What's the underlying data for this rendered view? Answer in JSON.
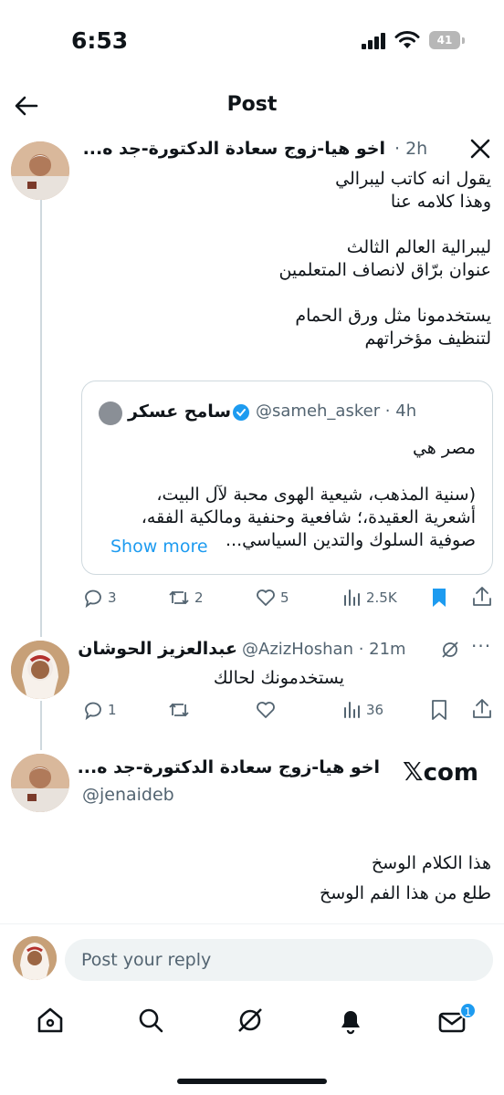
{
  "status_bar": {
    "time": "6:53",
    "battery": "41"
  },
  "header": {
    "title": "Post"
  },
  "post1": {
    "author": "اخو هيا-زوج سعادة الدكتورة-جد ه...",
    "time": "· 2h",
    "text": "يقول انه كاتب ليبرالي\nوهذا كلامه عنا\n\nليبرالية العالم الثالث\nعنوان برّاق لانصاف المتعلمين\n\nيستخدمونا مثل ورق الحمام\nلتنظيف مؤخراتهم",
    "quote": {
      "name": "سامح عسكر",
      "handle": "@sameh_asker · 4h",
      "line1": "مصر هي",
      "text": "(سنية المذهب، شيعية الهوى محبة لآل البيت،\nأشعرية العقيدة،؛ شافعية وحنفية ومالكية الفقه،\nصوفية السلوك والتدين السياسي...",
      "show_more": "Show more"
    },
    "stats": {
      "replies": "3",
      "reposts": "2",
      "likes": "5",
      "views": "2.5K"
    }
  },
  "post2": {
    "author": "عبدالعزيز الحوشان",
    "handle": "@AzizHoshan · 21m",
    "text": "يستخدمونك لحالك",
    "stats": {
      "replies": "1",
      "views": "36"
    }
  },
  "post3": {
    "source": "com",
    "author": "اخو هيا-زوج سعادة الدكتورة-جد ه...",
    "handle": "@jenaideb",
    "text": "هذا الكلام الوسخ\nطلع من هذا الفم الوسخ"
  },
  "reply_bar": {
    "placeholder": "Post your reply"
  },
  "bottom_nav": {
    "messages_badge": "1"
  },
  "colors": {
    "accent": "#1d9bf0",
    "text": "#0f1419",
    "muted": "#536471"
  }
}
